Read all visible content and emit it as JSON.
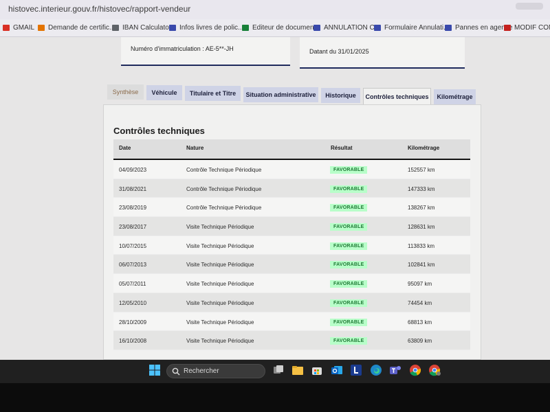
{
  "browser": {
    "url": "histovec.interieur.gouv.fr/histovec/rapport-vendeur",
    "bookmarks": [
      {
        "label": "GMAIL",
        "color": "#d93025"
      },
      {
        "label": "Demande de certific...",
        "color": "#e37400"
      },
      {
        "label": "IBAN Calculator",
        "color": "#5f6368"
      },
      {
        "label": "Infos livres de polic...",
        "color": "#3949ab"
      },
      {
        "label": "Editeur de documen...",
        "color": "#188038"
      },
      {
        "label": "ANNULATION C+",
        "color": "#3949ab"
      },
      {
        "label": "Formulaire Annulati...",
        "color": "#3949ab"
      },
      {
        "label": "Pannes en agence",
        "color": "#3949ab"
      },
      {
        "label": "MODIF CONTRA",
        "color": "#c5221f"
      }
    ]
  },
  "vehicle": {
    "immatriculation": "Numéro d'immatriculation : AE-5**-JH",
    "datant": "Datant du 31/01/2025"
  },
  "tabs": [
    {
      "label": "Synthèse",
      "active": false
    },
    {
      "label": "Véhicule",
      "active": false
    },
    {
      "label": "Titulaire et Titre",
      "active": false
    },
    {
      "label": "Situation administrative",
      "active": false
    },
    {
      "label": "Historique",
      "active": false
    },
    {
      "label": "Contrôles techniques",
      "active": true
    },
    {
      "label": "Kilométrage",
      "active": false
    }
  ],
  "section": {
    "title": "Contrôles techniques",
    "columns": [
      "Date",
      "Nature",
      "Résultat",
      "Kilométrage"
    ]
  },
  "rows": [
    {
      "date": "04/09/2023",
      "nature": "Contrôle Technique Périodique",
      "result": "FAVORABLE",
      "km": "152557 km"
    },
    {
      "date": "31/08/2021",
      "nature": "Contrôle Technique Périodique",
      "result": "FAVORABLE",
      "km": "147333 km"
    },
    {
      "date": "23/08/2019",
      "nature": "Contrôle Technique Périodique",
      "result": "FAVORABLE",
      "km": "138267 km"
    },
    {
      "date": "23/08/2017",
      "nature": "Visite Technique Périodique",
      "result": "FAVORABLE",
      "km": "128631 km"
    },
    {
      "date": "10/07/2015",
      "nature": "Visite Technique Périodique",
      "result": "FAVORABLE",
      "km": "113833 km"
    },
    {
      "date": "06/07/2013",
      "nature": "Visite Technique Périodique",
      "result": "FAVORABLE",
      "km": "102841 km"
    },
    {
      "date": "05/07/2011",
      "nature": "Visite Technique Périodique",
      "result": "FAVORABLE",
      "km": "95097 km"
    },
    {
      "date": "12/05/2010",
      "nature": "Visite Technique Périodique",
      "result": "FAVORABLE",
      "km": "74454 km"
    },
    {
      "date": "28/10/2009",
      "nature": "Visite Technique Périodique",
      "result": "FAVORABLE",
      "km": "68813 km"
    },
    {
      "date": "16/10/2008",
      "nature": "Visite Technique Périodique",
      "result": "FAVORABLE",
      "km": "63809 km"
    }
  ],
  "taskbar": {
    "search_label": "Rechercher",
    "icons": [
      "windows-start-icon",
      "task-view-icon",
      "file-explorer-icon",
      "store-icon",
      "outlook-icon",
      "app-l-icon",
      "edge-icon",
      "teams-icon",
      "chrome-icon",
      "chrome-profile-icon"
    ]
  },
  "colors": {
    "navy": "#1e2a5c",
    "tab_bg": "#cfd3e6",
    "badge_bg": "#b8fec9",
    "badge_text": "#1f7a35"
  }
}
